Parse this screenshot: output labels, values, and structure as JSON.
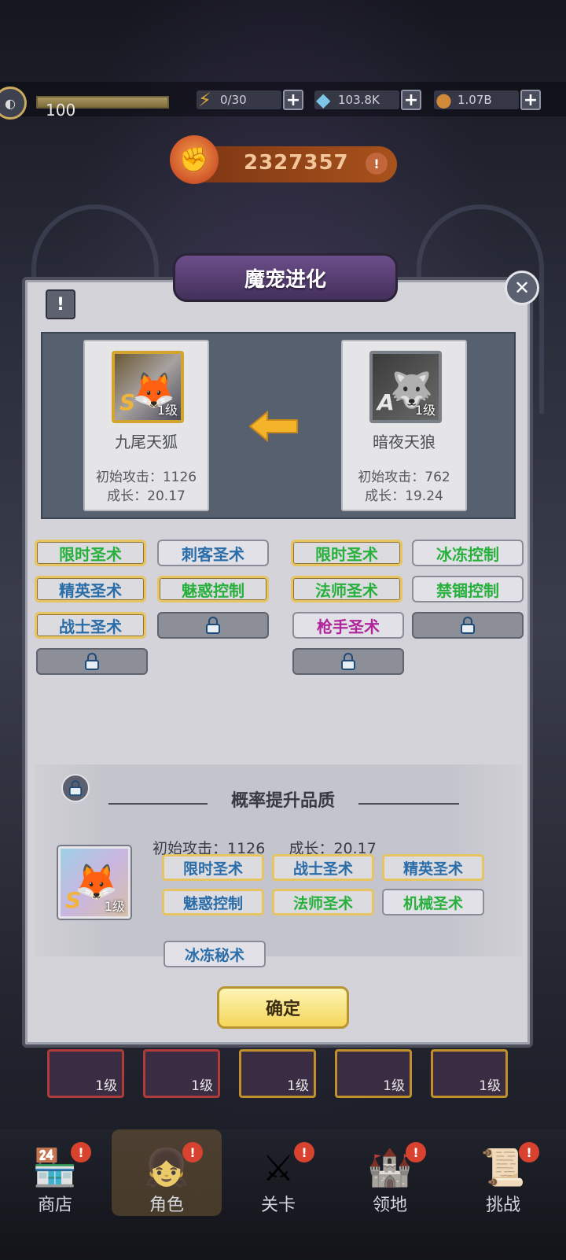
{
  "topbar": {
    "player_level": "100",
    "energy": "0/30",
    "gems": "103.8K",
    "coins": "1.07B",
    "power": "2327357"
  },
  "dialog": {
    "title": "魔宠进化",
    "target_pet": {
      "name": "九尾天狐",
      "grade": "S",
      "level": "1级",
      "attack": "初始攻击：1126",
      "growth": "成长：20.17",
      "skills": [
        {
          "label": "限时圣术",
          "color": "green",
          "highlighted": true
        },
        {
          "label": "刺客圣术",
          "color": "blue",
          "highlighted": false
        },
        {
          "label": "精英圣术",
          "color": "blue",
          "highlighted": true
        },
        {
          "label": "魅惑控制",
          "color": "green",
          "highlighted": true
        },
        {
          "label": "战士圣术",
          "color": "blue",
          "highlighted": true
        }
      ]
    },
    "source_pet": {
      "name": "暗夜天狼",
      "grade": "A",
      "level": "1级",
      "attack": "初始攻击：762",
      "growth": "成长：19.24",
      "skills": [
        {
          "label": "限时圣术",
          "color": "green",
          "highlighted": true
        },
        {
          "label": "冰冻控制",
          "color": "green",
          "highlighted": false
        },
        {
          "label": "法师圣术",
          "color": "green",
          "highlighted": true
        },
        {
          "label": "禁锢控制",
          "color": "green",
          "highlighted": false
        },
        {
          "label": "枪手圣术",
          "color": "purple",
          "highlighted": false
        }
      ]
    },
    "result": {
      "title": "概率提升品质",
      "attack": "初始攻击：1126",
      "growth": "成长：20.17",
      "grade": "S",
      "level": "1级",
      "skills": [
        {
          "label": "限时圣术",
          "color": "blue",
          "highlighted": true
        },
        {
          "label": "战士圣术",
          "color": "blue",
          "highlighted": true
        },
        {
          "label": "精英圣术",
          "color": "blue",
          "highlighted": true
        },
        {
          "label": "魅惑控制",
          "color": "blue",
          "highlighted": true
        },
        {
          "label": "法师圣术",
          "color": "green",
          "highlighted": true
        },
        {
          "label": "机械圣术",
          "color": "green",
          "highlighted": false
        },
        {
          "label": "冰冻秘术",
          "color": "blue",
          "highlighted": false
        }
      ]
    },
    "confirm_label": "确定"
  },
  "background_cards": {
    "level": "1级"
  },
  "nav": {
    "items": [
      {
        "label": "商店",
        "badge": "!"
      },
      {
        "label": "角色",
        "badge": "!"
      },
      {
        "label": "关卡",
        "badge": "!"
      },
      {
        "label": "领地",
        "badge": "!"
      },
      {
        "label": "挑战",
        "badge": "!"
      }
    ]
  }
}
